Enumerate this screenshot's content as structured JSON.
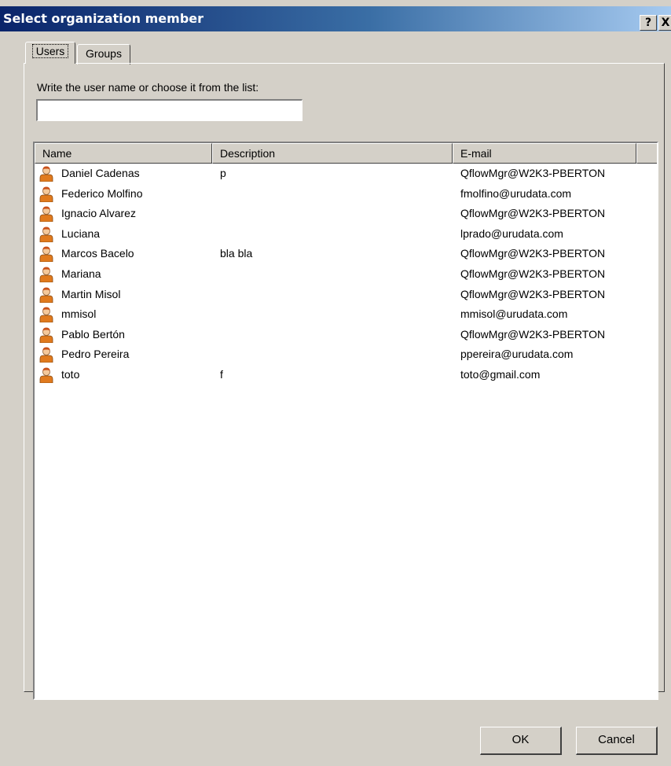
{
  "window": {
    "title": "Select organization member",
    "help_label": "?",
    "close_label": "X"
  },
  "tabs": [
    {
      "label": "Users",
      "selected": true
    },
    {
      "label": "Groups",
      "selected": false
    }
  ],
  "search": {
    "label": "Write the user name or choose it from the list:",
    "value": "",
    "placeholder": ""
  },
  "list": {
    "columns": [
      "Name",
      "Description",
      "E-mail"
    ],
    "rows": [
      {
        "name": "Daniel Cadenas",
        "description": "p",
        "email": "QflowMgr@W2K3-PBERTON"
      },
      {
        "name": "Federico  Molfino",
        "description": "",
        "email": "fmolfino@urudata.com"
      },
      {
        "name": "Ignacio Alvarez",
        "description": "",
        "email": "QflowMgr@W2K3-PBERTON"
      },
      {
        "name": "Luciana",
        "description": "",
        "email": "lprado@urudata.com"
      },
      {
        "name": "Marcos Bacelo",
        "description": "bla bla",
        "email": "QflowMgr@W2K3-PBERTON"
      },
      {
        "name": "Mariana",
        "description": "",
        "email": "QflowMgr@W2K3-PBERTON"
      },
      {
        "name": "Martin Misol",
        "description": "",
        "email": "QflowMgr@W2K3-PBERTON"
      },
      {
        "name": "mmisol",
        "description": "",
        "email": "mmisol@urudata.com"
      },
      {
        "name": "Pablo Bertón",
        "description": "",
        "email": "QflowMgr@W2K3-PBERTON"
      },
      {
        "name": "Pedro Pereira",
        "description": "",
        "email": "ppereira@urudata.com"
      },
      {
        "name": "toto",
        "description": "f",
        "email": "toto@gmail.com"
      }
    ],
    "row_icon": "user-icon"
  },
  "buttons": {
    "ok": "OK",
    "cancel": "Cancel"
  },
  "colors": {
    "titlebar_start": "#0a246a",
    "titlebar_end": "#a6caf0",
    "dialog_bg": "#d4d0c8"
  }
}
